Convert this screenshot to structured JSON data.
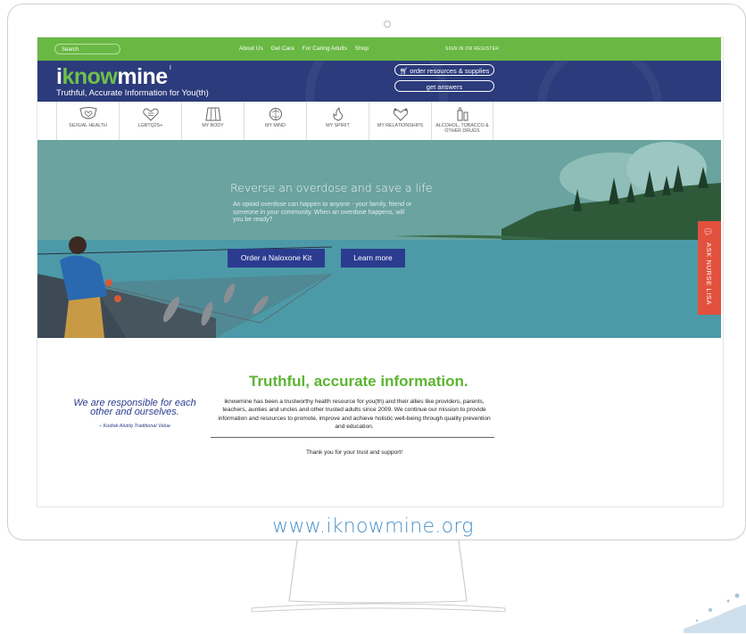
{
  "site_url": "www.iknowmine.org",
  "topbar": {
    "search_placeholder": "Search",
    "links": [
      "About Us",
      "Get Care",
      "For Caring Adults",
      "Shop"
    ],
    "signin": "SIGN IN OR REGISTER"
  },
  "header": {
    "logo_i": "i",
    "logo_know": "know",
    "logo_mine": "mine",
    "tagline": "Truthful, Accurate Information for You(th)",
    "order_button": "order resources & supplies",
    "answers_button": "get answers"
  },
  "categories": [
    {
      "label": "SEXUAL HEALTH",
      "icon": "heart-shield-icon"
    },
    {
      "label": "LGBTQ2S+",
      "icon": "heart-equal-icon"
    },
    {
      "label": "MY BODY",
      "icon": "body-icon"
    },
    {
      "label": "MY MIND",
      "icon": "brain-icon"
    },
    {
      "label": "MY SPIRIT",
      "icon": "flame-icon"
    },
    {
      "label": "MY RELATIONSHIPS",
      "icon": "hearts-icon"
    },
    {
      "label": "ALCOHOL, TOBACCO & OTHER DRUGS",
      "icon": "bottle-icon"
    }
  ],
  "hero": {
    "title": "Reverse an overdose and save a life",
    "body": "An opioid overdose can happen to anyone - your family, friend or someone in your community. When an overdose happens, will you be ready?",
    "order_button": "Order a Naloxone Kit",
    "learn_button": "Learn more"
  },
  "ask_nurse": "ASK NURSE LISA",
  "content": {
    "title": "Truthful, accurate information.",
    "body": "iknowmine has been a trustworthy health resource for you(th) and their allies like providers, parents, teachers, aunties and uncles and other trusted adults since 2009. We continue our mission to provide information and resources to promote, improve and achieve holistic well-being through quality prevention and education.",
    "thanks": "Thank you for your trust and support!",
    "quote": "We are responsible for each other and ourselves.",
    "quote_source": "– Kodiak Alutiiq Traditional Value"
  },
  "colors": {
    "green": "#69b843",
    "navy": "#2b3b7b",
    "nurse_red": "#e2513d",
    "url_blue": "#4a90c8"
  }
}
